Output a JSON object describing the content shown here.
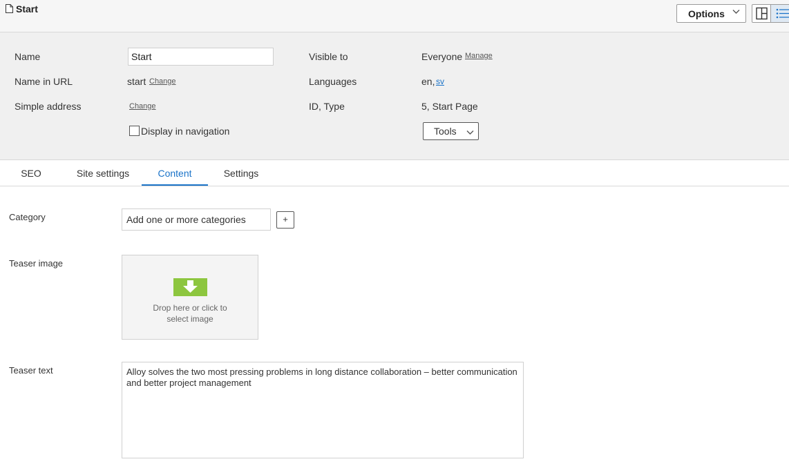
{
  "header": {
    "title": "Start",
    "options_label": "Options"
  },
  "properties": {
    "name_label": "Name",
    "name_value": "Start",
    "name_in_url_label": "Name in URL",
    "name_in_url_value": "start",
    "change_link": "Change",
    "simple_address_label": "Simple address",
    "display_in_navigation_label": "Display in navigation",
    "display_in_navigation_checked": false,
    "visible_to_label": "Visible to",
    "visible_to_value": "Everyone",
    "manage_link": "Manage",
    "languages_label": "Languages",
    "language_primary": "en,",
    "language_secondary": "sv",
    "id_type_label": "ID, Type",
    "id_type_value": "5, Start Page",
    "tools_label": "Tools"
  },
  "tabs": [
    {
      "label": "SEO",
      "active": false
    },
    {
      "label": "Site settings",
      "active": false
    },
    {
      "label": "Content",
      "active": true
    },
    {
      "label": "Settings",
      "active": false
    }
  ],
  "content": {
    "category_label": "Category",
    "category_placeholder": "Add one or more categories",
    "add_category_label": "+",
    "teaser_image_label": "Teaser image",
    "drop_line1": "Drop here or click to",
    "drop_line2": "select image",
    "teaser_text_label": "Teaser text",
    "teaser_text_value": "Alloy solves the two most pressing problems in long distance collaboration – better communication and better project management"
  },
  "colors": {
    "accent": "#1a73c8",
    "drop_icon": "#8dc63f"
  }
}
